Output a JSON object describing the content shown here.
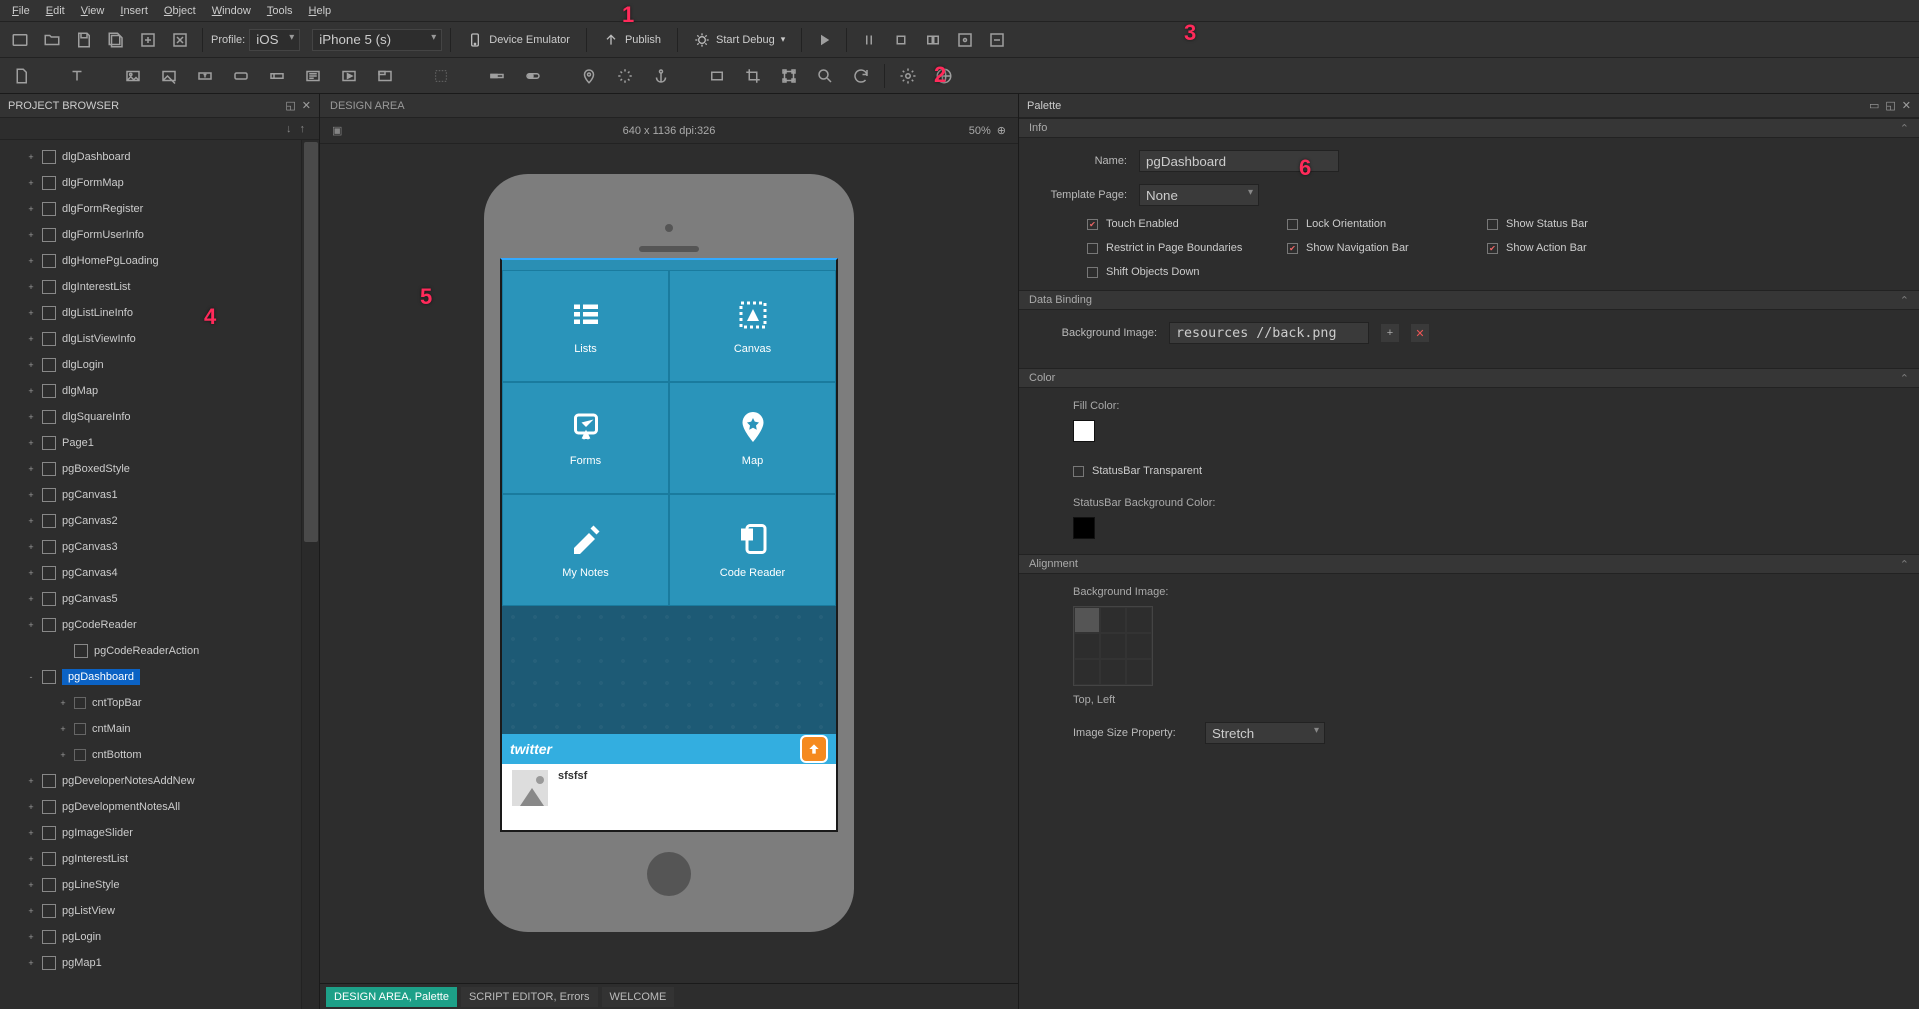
{
  "menu": [
    "File",
    "Edit",
    "View",
    "Insert",
    "Object",
    "Window",
    "Tools",
    "Help"
  ],
  "toolbar1": {
    "profile_label": "Profile:",
    "profile_value": "iOS",
    "device_value": "iPhone 5 (s)",
    "device_emulator": "Device Emulator",
    "publish": "Publish",
    "start_debug": "Start Debug"
  },
  "project_browser": {
    "title": "PROJECT BROWSER",
    "items": [
      {
        "label": "dlgDashboard",
        "expand": "+"
      },
      {
        "label": "dlgFormMap",
        "expand": "+"
      },
      {
        "label": "dlgFormRegister",
        "expand": "+"
      },
      {
        "label": "dlgFormUserInfo",
        "expand": "+"
      },
      {
        "label": "dlgHomePgLoading",
        "expand": "+"
      },
      {
        "label": "dlgInterestList",
        "expand": "+"
      },
      {
        "label": "dlgListLineInfo",
        "expand": "+"
      },
      {
        "label": "dlgListViewInfo",
        "expand": "+"
      },
      {
        "label": "dlgLogin",
        "expand": "+"
      },
      {
        "label": "dlgMap",
        "expand": "+"
      },
      {
        "label": "dlgSquareInfo",
        "expand": "+"
      },
      {
        "label": "Page1",
        "expand": "+"
      },
      {
        "label": "pgBoxedStyle",
        "expand": "+"
      },
      {
        "label": "pgCanvas1",
        "expand": "+"
      },
      {
        "label": "pgCanvas2",
        "expand": "+"
      },
      {
        "label": "pgCanvas3",
        "expand": "+"
      },
      {
        "label": "pgCanvas4",
        "expand": "+"
      },
      {
        "label": "pgCanvas5",
        "expand": "+"
      },
      {
        "label": "pgCodeReader",
        "expand": "+"
      },
      {
        "label": "pgCodeReaderAction",
        "expand": "",
        "child": true,
        "noicon": false
      },
      {
        "label": "pgDashboard",
        "expand": "-",
        "selected": true
      },
      {
        "label": "cntTopBar",
        "expand": "+",
        "child": true,
        "sub": true
      },
      {
        "label": "cntMain",
        "expand": "+",
        "child": true,
        "sub": true
      },
      {
        "label": "cntBottom",
        "expand": "+",
        "child": true,
        "sub": true
      },
      {
        "label": "pgDeveloperNotesAddNew",
        "expand": "+"
      },
      {
        "label": "pgDevelopmentNotesAll",
        "expand": "+"
      },
      {
        "label": "pgImageSlider",
        "expand": "+"
      },
      {
        "label": "pgInterestList",
        "expand": "+"
      },
      {
        "label": "pgLineStyle",
        "expand": "+"
      },
      {
        "label": "pgListView",
        "expand": "+"
      },
      {
        "label": "pgLogin",
        "expand": "+"
      },
      {
        "label": "pgMap1",
        "expand": "+"
      }
    ]
  },
  "design": {
    "title": "DESIGN AREA",
    "dimensions": "640 x 1136 dpi:326",
    "zoom": "50%",
    "tiles": [
      "Lists",
      "Canvas",
      "Forms",
      "Map",
      "My Notes",
      "Code Reader"
    ],
    "twitter": "twitter",
    "bottom_text": "sfsfsf"
  },
  "footer": {
    "tabs": [
      "DESIGN AREA, Palette",
      "SCRIPT EDITOR, Errors",
      "WELCOME"
    ]
  },
  "palette": {
    "title": "Palette",
    "info": "Info",
    "name_label": "Name:",
    "name_value": "pgDashboard",
    "template_label": "Template Page:",
    "template_value": "None",
    "checks": [
      {
        "label": "Touch Enabled",
        "checked": true
      },
      {
        "label": "Lock Orientation",
        "checked": false
      },
      {
        "label": "Show Status Bar",
        "checked": false
      },
      {
        "label": "Restrict in Page Boundaries",
        "checked": false
      },
      {
        "label": "Show Navigation Bar",
        "checked": true
      },
      {
        "label": "Show Action Bar",
        "checked": true
      },
      {
        "label": "Shift Objects Down",
        "checked": false
      }
    ],
    "data_binding": "Data Binding",
    "bg_image_label": "Background Image:",
    "bg_image_value": "resources //back.png",
    "color_section": "Color",
    "fill_color_label": "Fill Color:",
    "fill_color": "#ffffff",
    "statusbar_transparent": "StatusBar Transparent",
    "statusbar_bg_label": "StatusBar Background Color:",
    "statusbar_bg": "#000000",
    "alignment_section": "Alignment",
    "alignment_bgimg_label": "Background Image:",
    "alignment_value": "Top, Left",
    "image_size_label": "Image Size Property:",
    "image_size_value": "Stretch"
  },
  "annotations": {
    "a1": "1",
    "a2": "2",
    "a3": "3",
    "a4": "4",
    "a5": "5",
    "a6": "6"
  }
}
